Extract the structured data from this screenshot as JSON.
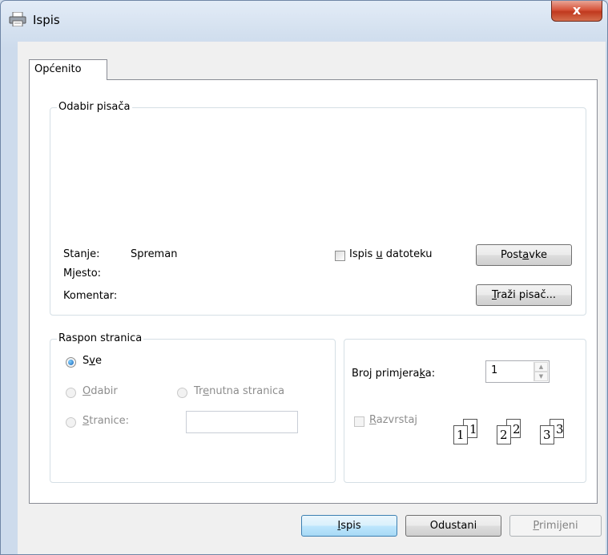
{
  "window": {
    "title": "Ispis",
    "close_label": "x"
  },
  "tabs": [
    {
      "label": "Općenito"
    }
  ],
  "printer_group": {
    "label": "Odabir pisača",
    "status_label": "Stanje:",
    "status_value": "Spreman",
    "location_label": "Mjesto:",
    "comment_label": "Komentar:",
    "print_to_file": {
      "pre": "Ispis ",
      "key": "u",
      "post": " datoteku",
      "checked": false
    },
    "preferences_button": {
      "pre": "Post",
      "key": "a",
      "post": "vke"
    },
    "find_printer_button": {
      "pre": "",
      "key": "T",
      "post": "raži pisač..."
    }
  },
  "range_group": {
    "label": "Raspon stranica",
    "all": {
      "pre": "S",
      "key": "v",
      "post": "e",
      "selected": true
    },
    "selection": {
      "pre": "",
      "key": "O",
      "post": "dabir",
      "enabled": false
    },
    "current_page": {
      "pre": "Tr",
      "key": "e",
      "post": "nutna stranica",
      "enabled": false
    },
    "pages": {
      "pre": "",
      "key": "S",
      "post": "tranice:",
      "enabled": false,
      "value": ""
    }
  },
  "copies_group": {
    "copies_label": {
      "pre": "Broj primjera",
      "key": "k",
      "post": "a:"
    },
    "copies_value": "1",
    "collate": {
      "pre": "",
      "key": "R",
      "post": "azvrstaj",
      "checked": false,
      "enabled": false
    },
    "collate_pages": [
      "1",
      "1",
      "2",
      "2",
      "3",
      "3"
    ]
  },
  "footer": {
    "print_button": {
      "pre": "",
      "key": "I",
      "post": "spis"
    },
    "cancel_button": "Odustani",
    "apply_button": {
      "pre": "",
      "key": "P",
      "post": "rimijeni",
      "enabled": false
    }
  }
}
